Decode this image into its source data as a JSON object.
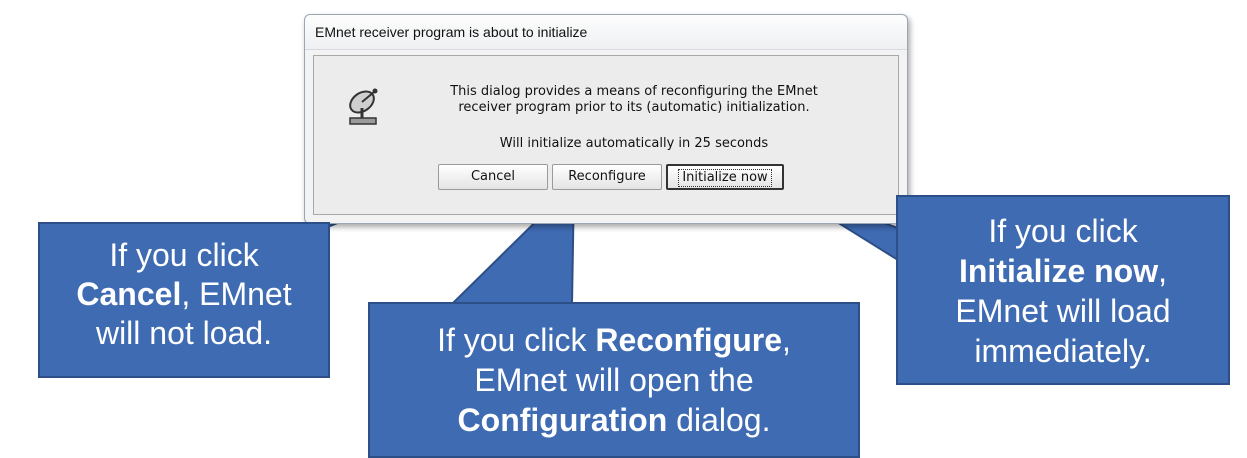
{
  "dialog": {
    "title": "EMnet receiver program is about to initialize",
    "message_line1": "This dialog provides a means of reconfiguring the EMnet",
    "message_line2": "receiver program prior to its (automatic) initialization.",
    "countdown": "Will initialize automatically in 25 seconds",
    "icon": "satellite-dish-icon",
    "buttons": {
      "cancel": "Cancel",
      "reconfigure": "Reconfigure",
      "initialize": "Initialize now"
    }
  },
  "callouts": {
    "cancel": {
      "line1": "If you click",
      "bold": "Cancel",
      "after": ", EMnet",
      "line3": "will not load."
    },
    "reconfigure": {
      "before": "If you click ",
      "bold": "Reconfigure",
      "after": ",",
      "line2": "EMnet will open the",
      "bold2": "Configuration",
      "after2": " dialog."
    },
    "initialize": {
      "line1": "If you click",
      "bold": "Initialize now",
      "after": ",",
      "line3": "EMnet will load",
      "line4": "immediately."
    }
  },
  "colors": {
    "callout_fill": "#3f6bb3",
    "callout_border": "#2d4f87",
    "window_bg": "#f3f3f3"
  }
}
